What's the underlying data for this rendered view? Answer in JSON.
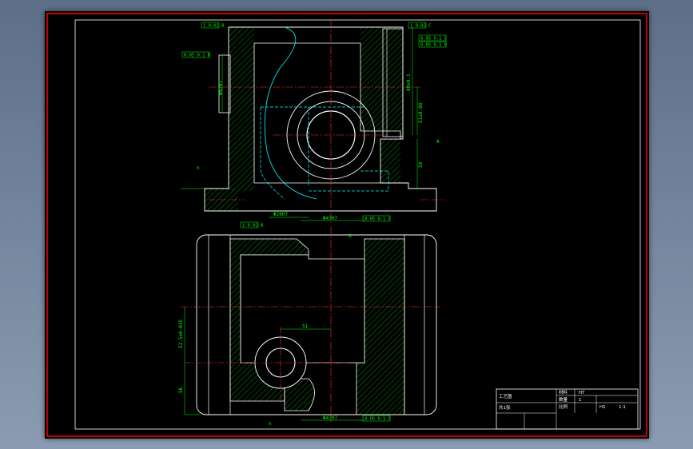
{
  "drawing": {
    "colors": {
      "sheet": "#000000",
      "outline": "#ffffff",
      "border": "#ff0000",
      "centerline": "#ff2a2a",
      "dimension": "#00ff00",
      "hatch": "#00cc00",
      "hidden": "#00ffff"
    }
  },
  "top_view": {
    "callouts": [
      "1 0.02 B",
      "0.05 0.1 B",
      "1 0.02 C",
      "0.05 0.1 C",
      "0.05 0.1 D"
    ],
    "dims": [
      "Φ47H7",
      "80±0.1",
      "51±0.08",
      "50",
      "Φ26H7",
      "Φ47H7",
      "0.05 0.1 C"
    ],
    "labels": [
      "A",
      "n"
    ]
  },
  "bottom_view": {
    "dims": [
      "51",
      "52.5±0.035",
      "56",
      "Φ47H7"
    ],
    "callouts": [
      "1 0.02 B",
      "0.05 0.1 C",
      "0.05 0.1 C"
    ],
    "labels": [
      "A",
      "n"
    ]
  },
  "title_block": {
    "part_name": "工艺图",
    "row_labels": [
      "材料",
      "数量",
      "比例"
    ],
    "values": [
      "HT",
      "1",
      "1:1"
    ],
    "drawing_no": "H1",
    "sheet": "共1张"
  }
}
